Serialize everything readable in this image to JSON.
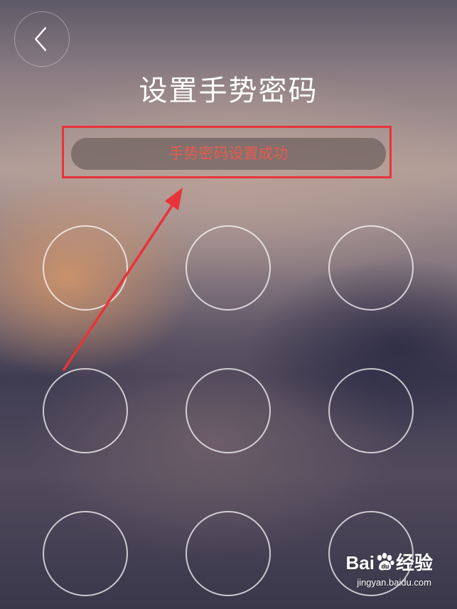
{
  "header": {
    "title": "设置手势密码",
    "back_icon": "chevron-left-icon"
  },
  "toast": {
    "message": "手势密码设置成功",
    "text_color": "#e65b4e"
  },
  "annotation": {
    "highlight_color": "#e8333a"
  },
  "gesture_grid": {
    "rows": 3,
    "cols": 3,
    "dots": [
      {
        "id": 1
      },
      {
        "id": 2
      },
      {
        "id": 3
      },
      {
        "id": 4
      },
      {
        "id": 5
      },
      {
        "id": 6
      },
      {
        "id": 7
      },
      {
        "id": 8
      },
      {
        "id": 9
      }
    ]
  },
  "watermark": {
    "brand_left": "Bai",
    "brand_right": "经验",
    "paw_icon": "paw-icon",
    "url": "jingyan.baidu.com"
  }
}
